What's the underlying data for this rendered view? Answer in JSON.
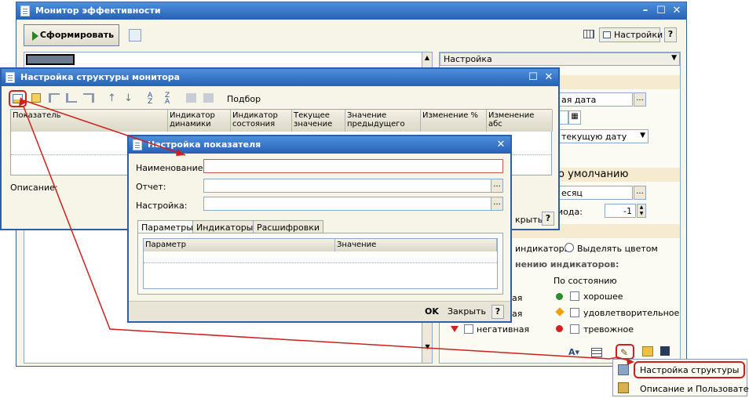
{
  "main_window": {
    "title": "Монитор эффективности",
    "generate_button": "Сформировать",
    "settings_button": "Настройки",
    "help_button": "?",
    "settings_panel": {
      "header_select": "Настройка",
      "date_field_fragment": "ая дата",
      "current_date_fragment": "текущую дату",
      "default_section": "о умолчанию",
      "period_fragment": "есяц",
      "period_label_fragment": "иода:",
      "period_value": "-1",
      "indicators_fragment": "индикаторы",
      "highlight_color": "Выделять цветом",
      "indicator_values_fragment": "нению индикаторов:",
      "by_state": "По состоянию",
      "dyn_fragment_1": "ая",
      "dyn_fragment_2": "ая",
      "negative": "негативная",
      "state_good": "хорошее",
      "state_ok": "удовлетворительное",
      "state_alarm": "тревожное"
    },
    "close_fragment": "крыть"
  },
  "structure_window": {
    "title": "Настройка структуры монитора",
    "podbor": "Подбор",
    "columns": [
      "Показатель",
      "Индикатор динамики",
      "Индикатор состояния",
      "Текущее значение",
      "Значение предыдущего",
      "Изменение %",
      "Изменение абс"
    ],
    "description_label": "Описание:"
  },
  "indicator_window": {
    "title": "Настройка показателя",
    "name_label": "Наименование:",
    "report_label": "Отчет:",
    "setting_label": "Настройка:",
    "tabs": [
      "Параметры",
      "Индикаторы",
      "Расшифровки"
    ],
    "grid_columns": [
      "Параметр",
      "Значение"
    ],
    "ok_button": "OK",
    "close_button": "Закрыть",
    "help_button": "?"
  },
  "popup_menu": {
    "items": [
      "Настройка структуры",
      "Описание и Пользователи"
    ]
  },
  "colors": {
    "title_bar": "#2860b5",
    "highlight_red": "#cc2020",
    "good": "#2e8b2e",
    "ok": "#f0a000",
    "alarm": "#d02020"
  }
}
